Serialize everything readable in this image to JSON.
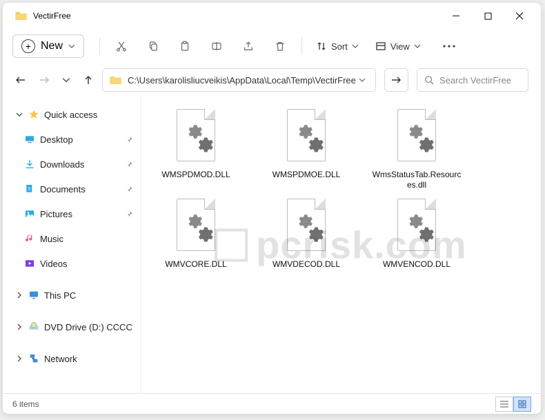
{
  "window": {
    "title": "VectirFree"
  },
  "toolbar": {
    "new_label": "New",
    "sort_label": "Sort",
    "view_label": "View"
  },
  "address": {
    "path": "C:\\Users\\karolisliucveikis\\AppData\\Local\\Temp\\VectirFree"
  },
  "search": {
    "placeholder": "Search VectirFree"
  },
  "sidebar": {
    "quick_access": "Quick access",
    "items": [
      {
        "label": "Desktop",
        "color": "#2aa9e0",
        "pinned": true
      },
      {
        "label": "Downloads",
        "color": "#2aa9e0",
        "pinned": true
      },
      {
        "label": "Documents",
        "color": "#2aa9e0",
        "pinned": true
      },
      {
        "label": "Pictures",
        "color": "#2aa9e0",
        "pinned": true
      },
      {
        "label": "Music",
        "color": "#e05a9a",
        "pinned": false
      },
      {
        "label": "Videos",
        "color": "#7a3fe0",
        "pinned": false
      }
    ],
    "this_pc": "This PC",
    "dvd": "DVD Drive (D:) CCCC",
    "network": "Network"
  },
  "files": [
    {
      "name": "WMSPDMOD.DLL"
    },
    {
      "name": "WMSPDMOE.DLL"
    },
    {
      "name": "WmsStatusTab.Resources.dll"
    },
    {
      "name": "WMVCORE.DLL"
    },
    {
      "name": "WMVDECOD.DLL"
    },
    {
      "name": "WMVENCOD.DLL"
    }
  ],
  "status": {
    "count_text": "6 items"
  },
  "watermark": {
    "text": "pcrisk.com"
  }
}
